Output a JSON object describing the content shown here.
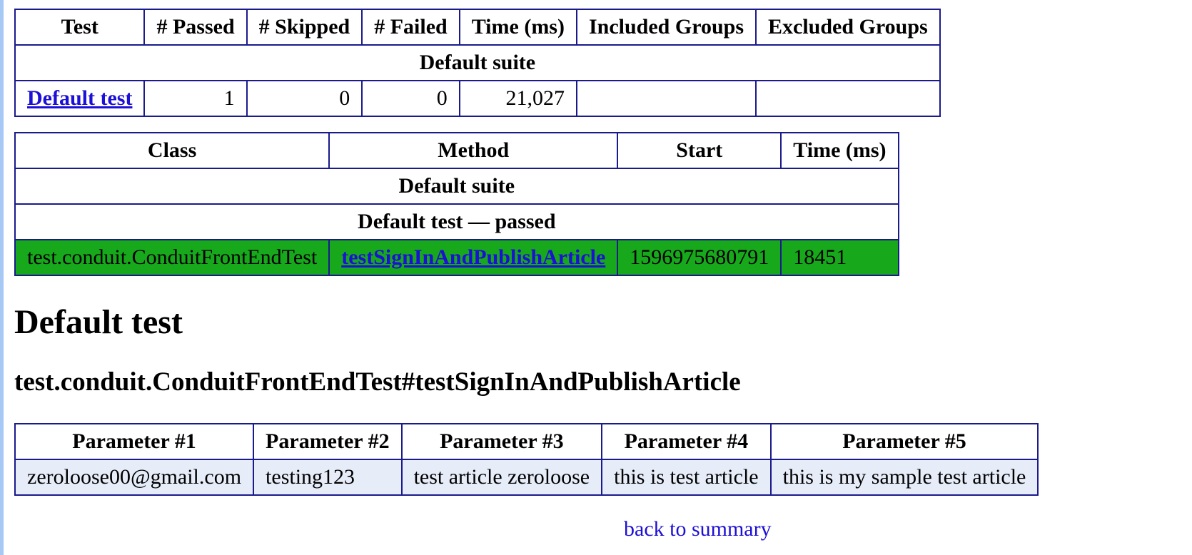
{
  "summary": {
    "headers": [
      "Test",
      "# Passed",
      "# Skipped",
      "# Failed",
      "Time (ms)",
      "Included Groups",
      "Excluded Groups"
    ],
    "suite_label": "Default suite",
    "row": {
      "test": "Default test",
      "passed": "1",
      "skipped": "0",
      "failed": "0",
      "time": "21,027",
      "included": "",
      "excluded": ""
    }
  },
  "methods": {
    "headers": [
      "Class",
      "Method",
      "Start",
      "Time (ms)"
    ],
    "suite_label": "Default suite",
    "test_label": "Default test — passed",
    "row": {
      "class": "test.conduit.ConduitFrontEndTest",
      "method": "testSignInAndPublishArticle",
      "start": "1596975680791",
      "time": "18451"
    }
  },
  "section_title": "Default test",
  "method_title": "test.conduit.ConduitFrontEndTest#testSignInAndPublishArticle",
  "params": {
    "headers": [
      "Parameter #1",
      "Parameter #2",
      "Parameter #3",
      "Parameter #4",
      "Parameter #5"
    ],
    "values": [
      "zeroloose00@gmail.com",
      "testing123",
      "test article zeroloose",
      "this is test article",
      "this is my sample test article"
    ]
  },
  "back_link": "back to summary",
  "colors": {
    "border": "#1a1a8c",
    "passed_row": "#18a81c",
    "param_row": "#e6ecf8",
    "link": "#1c0fd6",
    "left_bar": "#a6c8f5"
  }
}
